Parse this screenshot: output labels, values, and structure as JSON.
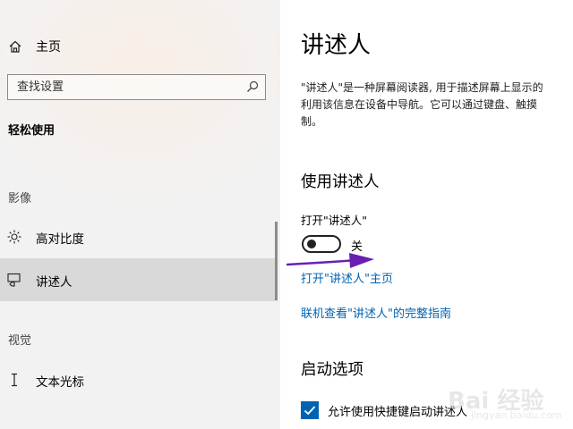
{
  "sidebar": {
    "home_label": "主页",
    "search_placeholder": "查找设置",
    "section_title": "轻松使用",
    "group_vision": "影像",
    "items": [
      {
        "label": "高对比度",
        "icon": "brightness-icon"
      },
      {
        "label": "讲述人",
        "icon": "narrator-icon",
        "selected": true
      },
      {
        "label": "文本光标",
        "icon": "text-cursor-icon"
      }
    ],
    "group_view": "视觉"
  },
  "main": {
    "title": "讲述人",
    "description_lines": [
      "\"讲述人\"是一种屏幕阅读器, 用于描述屏幕上显示的",
      "利用该信息在设备中导航。它可以通过键盘、触摸",
      "制。"
    ],
    "section_use": "使用讲述人",
    "toggle_label": "打开\"讲述人\"",
    "toggle_state": "关",
    "toggle_on": false,
    "link_home": "打开\"讲述人\"主页",
    "link_guide": "联机查看\"讲述人\"的完整指南",
    "section_startup": "启动选项",
    "checkbox_label": "允许使用快捷键启动讲述人",
    "checkbox_checked": true
  },
  "colors": {
    "accent": "#0063b1",
    "selected_bg": "#d9d9d9",
    "arrow": "#6a1fb3"
  },
  "watermark": {
    "text": "Bai 经验",
    "sub": "jingyan.baidu.com"
  }
}
